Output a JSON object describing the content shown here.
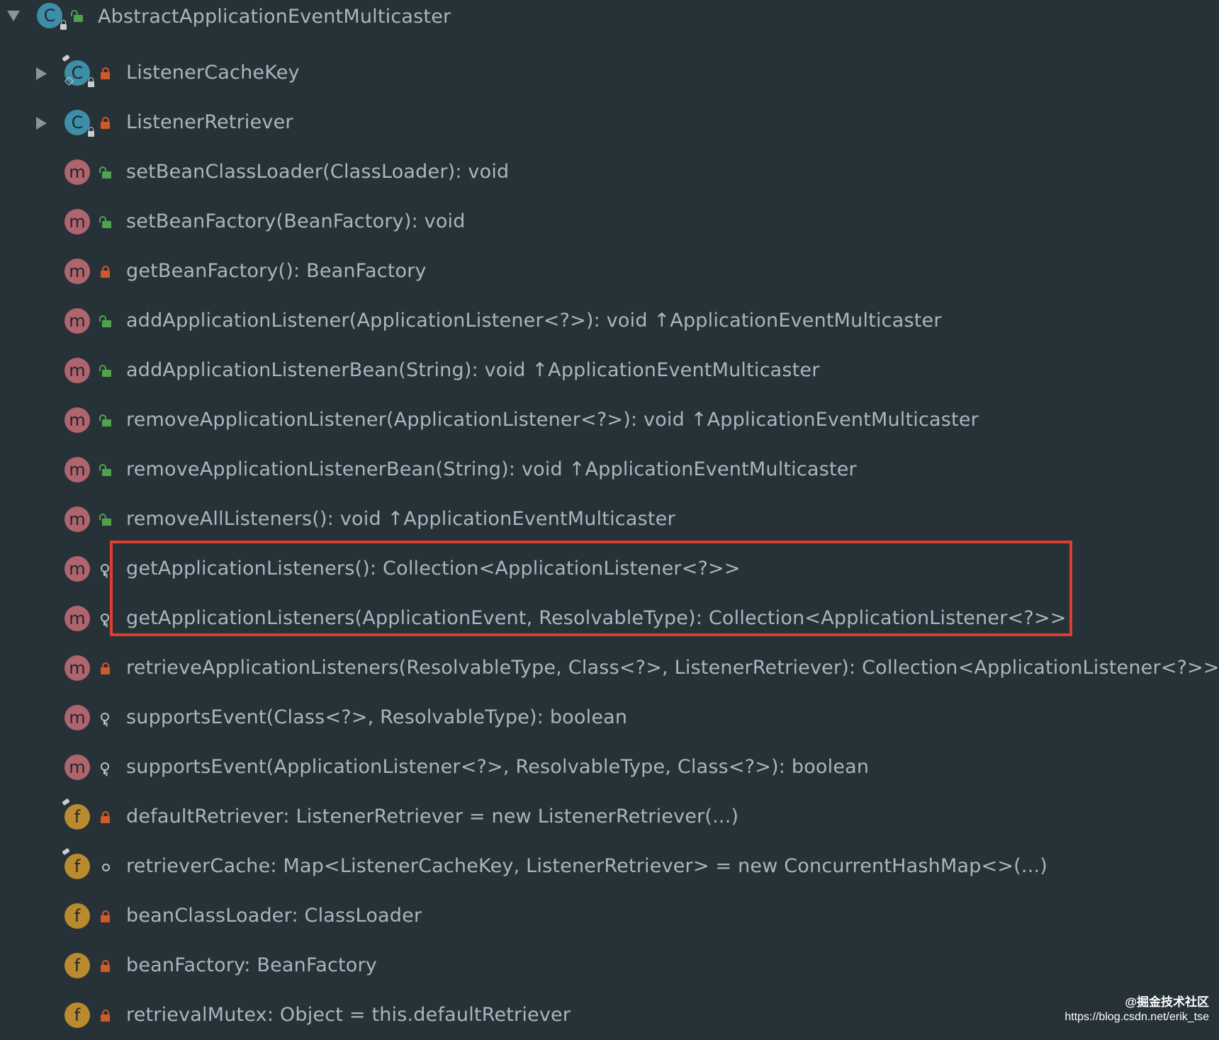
{
  "structure_tree": {
    "root": {
      "label": "AbstractApplicationEventMulticaster",
      "kind": "class",
      "kind_letter": "C",
      "visibility": "public",
      "expanded": true
    },
    "items": [
      {
        "label": "ListenerCacheKey",
        "kind": "class",
        "kind_letter": "C",
        "visibility": "private",
        "expandable": true
      },
      {
        "label": "ListenerRetriever",
        "kind": "class",
        "kind_letter": "C",
        "visibility": "private",
        "expandable": true
      },
      {
        "label": "setBeanClassLoader(ClassLoader): void",
        "kind": "method",
        "kind_letter": "m",
        "visibility": "public"
      },
      {
        "label": "setBeanFactory(BeanFactory): void",
        "kind": "method",
        "kind_letter": "m",
        "visibility": "public"
      },
      {
        "label": "getBeanFactory(): BeanFactory",
        "kind": "method",
        "kind_letter": "m",
        "visibility": "private"
      },
      {
        "label": "addApplicationListener(ApplicationListener<?>): void ↑ApplicationEventMulticaster",
        "kind": "method",
        "kind_letter": "m",
        "visibility": "public"
      },
      {
        "label": "addApplicationListenerBean(String): void ↑ApplicationEventMulticaster",
        "kind": "method",
        "kind_letter": "m",
        "visibility": "public"
      },
      {
        "label": "removeApplicationListener(ApplicationListener<?>): void ↑ApplicationEventMulticaster",
        "kind": "method",
        "kind_letter": "m",
        "visibility": "public"
      },
      {
        "label": "removeApplicationListenerBean(String): void ↑ApplicationEventMulticaster",
        "kind": "method",
        "kind_letter": "m",
        "visibility": "public"
      },
      {
        "label": "removeAllListeners(): void ↑ApplicationEventMulticaster",
        "kind": "method",
        "kind_letter": "m",
        "visibility": "public"
      },
      {
        "label": "getApplicationListeners(): Collection<ApplicationListener<?>>",
        "kind": "method",
        "kind_letter": "m",
        "visibility": "protected"
      },
      {
        "label": "getApplicationListeners(ApplicationEvent, ResolvableType): Collection<ApplicationListener<?>>",
        "kind": "method",
        "kind_letter": "m",
        "visibility": "protected"
      },
      {
        "label": "retrieveApplicationListeners(ResolvableType, Class<?>, ListenerRetriever): Collection<ApplicationListener<?>>",
        "kind": "method",
        "kind_letter": "m",
        "visibility": "private"
      },
      {
        "label": "supportsEvent(Class<?>, ResolvableType): boolean",
        "kind": "method",
        "kind_letter": "m",
        "visibility": "protected"
      },
      {
        "label": "supportsEvent(ApplicationListener<?>, ResolvableType, Class<?>): boolean",
        "kind": "method",
        "kind_letter": "m",
        "visibility": "protected"
      },
      {
        "label": "defaultRetriever: ListenerRetriever = new ListenerRetriever(...)",
        "kind": "field",
        "kind_letter": "f",
        "visibility": "private"
      },
      {
        "label": "retrieverCache: Map<ListenerCacheKey, ListenerRetriever> = new ConcurrentHashMap<>(...)",
        "kind": "field",
        "kind_letter": "f",
        "visibility": "package"
      },
      {
        "label": "beanClassLoader: ClassLoader",
        "kind": "field",
        "kind_letter": "f",
        "visibility": "private"
      },
      {
        "label": "beanFactory: BeanFactory",
        "kind": "field",
        "kind_letter": "f",
        "visibility": "private"
      },
      {
        "label": "retrievalMutex: Object = this.defaultRetriever",
        "kind": "field",
        "kind_letter": "f",
        "visibility": "private"
      }
    ]
  },
  "watermark": {
    "top": "@掘金技术社区",
    "bottom": "https://blog.csdn.net/erik_tse"
  },
  "colors": {
    "background": "#263238",
    "text": "#a9b6bd",
    "highlight_border": "#e03e2d",
    "class_icon": "#3d8fa8",
    "method_icon": "#b0646e",
    "field_icon": "#b98a2e",
    "public_lock": "#4fa34c",
    "private_lock": "#d0592a"
  }
}
